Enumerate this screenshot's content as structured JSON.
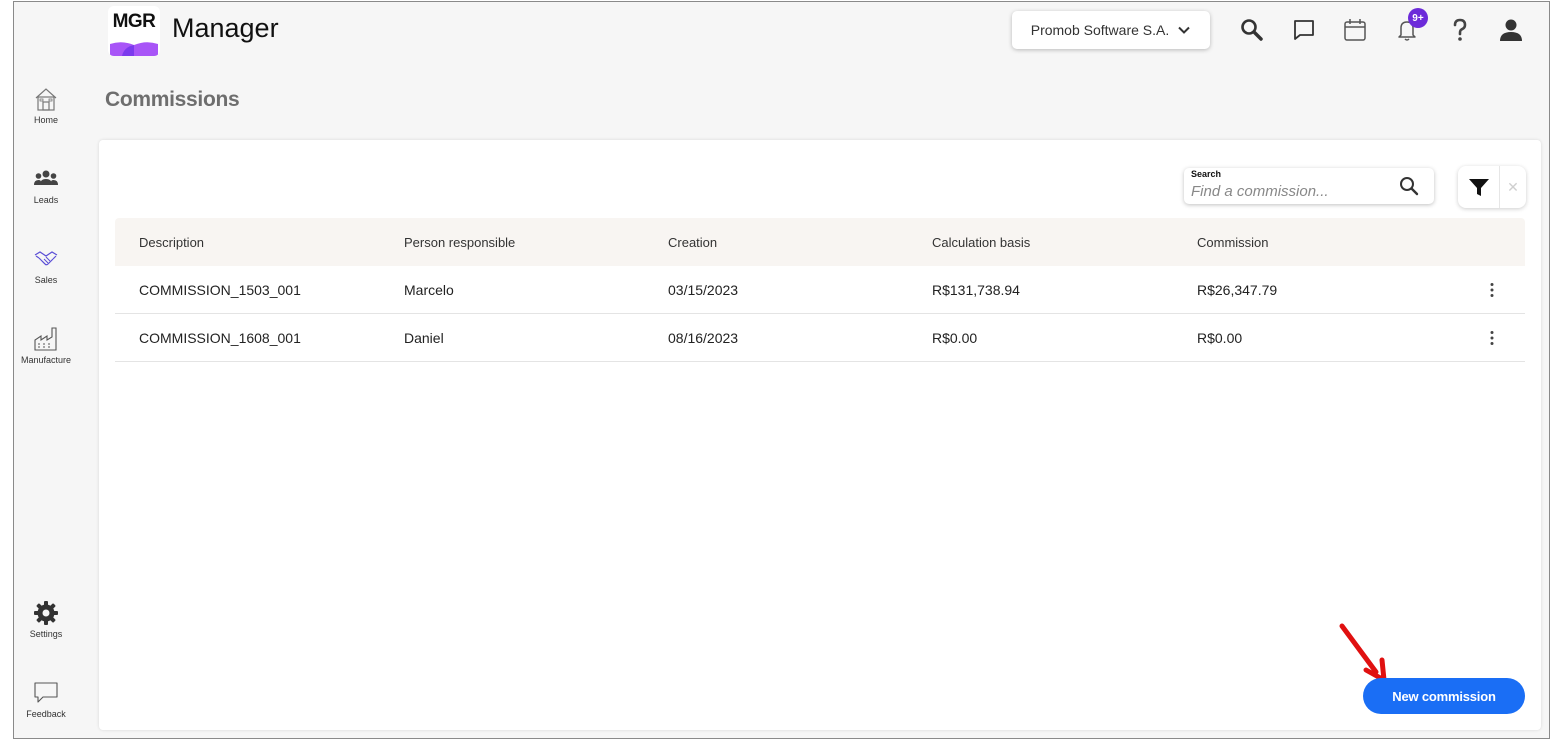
{
  "app": {
    "logo_text": "MGR",
    "title": "Manager",
    "accent": "#a855f7",
    "accent_dark": "#6c2bd9"
  },
  "header": {
    "company": "Promob Software S.A.",
    "notification_badge": "9+"
  },
  "sidebar": {
    "items": [
      {
        "label": "Home",
        "icon": "home-icon"
      },
      {
        "label": "Leads",
        "icon": "users-icon"
      },
      {
        "label": "Sales",
        "icon": "handshake-icon"
      },
      {
        "label": "Manufacture",
        "icon": "factory-icon"
      }
    ],
    "bottom": [
      {
        "label": "Settings",
        "icon": "gear-icon"
      },
      {
        "label": "Feedback",
        "icon": "chat-icon"
      }
    ]
  },
  "page": {
    "title": "Commissions"
  },
  "search": {
    "label": "Search",
    "placeholder": "Find a commission..."
  },
  "table": {
    "columns": [
      "Description",
      "Person responsible",
      "Creation",
      "Calculation basis",
      "Commission"
    ],
    "rows": [
      [
        "COMMISSION_1503_001",
        "Marcelo",
        "03/15/2023",
        "R$131,738.94",
        "R$26,347.79"
      ],
      [
        "COMMISSION_1608_001",
        "Daniel",
        "08/16/2023",
        "R$0.00",
        "R$0.00"
      ]
    ]
  },
  "actions": {
    "new_commission": "New commission",
    "button_color": "#1a6ef5"
  },
  "annotation": {
    "arrow_color": "#e01010"
  }
}
